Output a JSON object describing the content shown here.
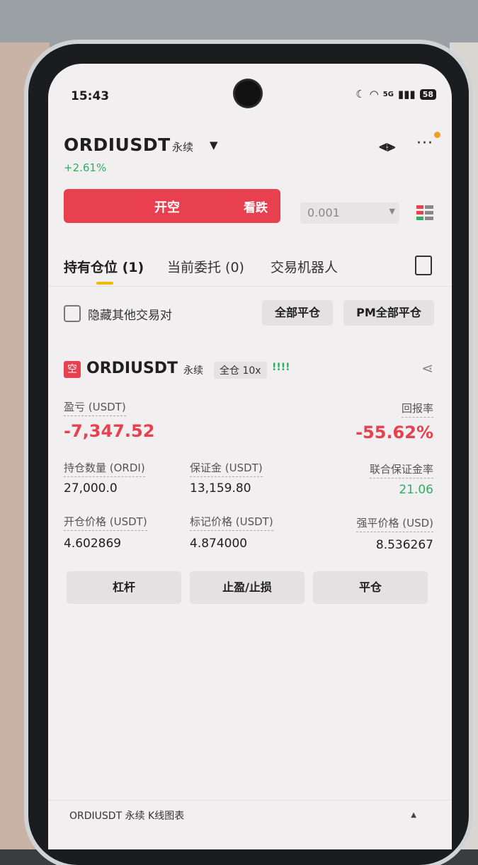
{
  "status_bar": {
    "time": "15:43",
    "signal": "5G",
    "battery": "58"
  },
  "header": {
    "symbol": "ORDIUSDT",
    "contract_type": "永续",
    "change": "+2.61%"
  },
  "order": {
    "short_label": "开空",
    "bearish_label": "看跌",
    "quantity": "0.001"
  },
  "tabs": [
    {
      "label": "持有仓位 (1)"
    },
    {
      "label": "当前委托 (0)"
    },
    {
      "label": "交易机器人"
    }
  ],
  "filters": {
    "hide_others_label": "隐藏其他交易对",
    "close_all_label": "全部平仓",
    "pm_close_all_label": "PM全部平仓"
  },
  "position": {
    "side_badge": "空",
    "symbol": "ORDIUSDT",
    "contract_type": "永续",
    "margin_mode": "全仓 10x",
    "risk_bars": "!!!!",
    "pnl_label": "盈亏 (USDT)",
    "pnl_value": "-7,347.52",
    "roe_label": "回报率",
    "roe_value": "-55.62%",
    "size_label": "持仓数量 (ORDI)",
    "size_value": "27,000.0",
    "margin_label": "保证金 (USDT)",
    "margin_value": "13,159.80",
    "margin_ratio_label": "联合保证金率",
    "margin_ratio_value": "21.06",
    "entry_label": "开仓价格 (USDT)",
    "entry_value": "4.602869",
    "mark_label": "标记价格 (USDT)",
    "mark_value": "4.874000",
    "liq_label": "强平价格 (USD)",
    "liq_value": "8.536267"
  },
  "actions": {
    "leverage": "杠杆",
    "tpsl": "止盈/止损",
    "close": "平仓"
  },
  "footer": {
    "kline_label": "ORDIUSDT 永续 K线图表"
  },
  "colors": {
    "red": "#e8404f",
    "green": "#2fae62",
    "accent": "#f0b90b"
  }
}
